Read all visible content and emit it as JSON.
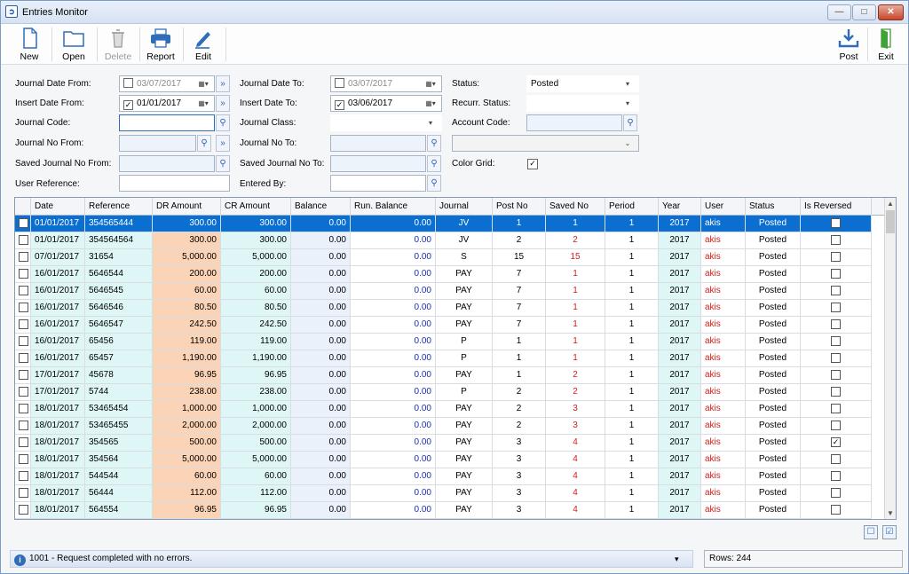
{
  "window": {
    "title": "Entries Monitor",
    "minimize": "—",
    "maximize": "□",
    "close": "✕"
  },
  "toolbar": {
    "new": "New",
    "open": "Open",
    "delete": "Delete",
    "report": "Report",
    "edit": "Edit",
    "post": "Post",
    "exit": "Exit"
  },
  "filters": {
    "journal_date_from_label": "Journal Date From:",
    "journal_date_from": "03/07/2017",
    "insert_date_from_label": "Insert Date From:",
    "insert_date_from": "01/01/2017",
    "journal_code_label": "Journal Code:",
    "journal_no_from_label": "Journal No From:",
    "saved_journal_no_from_label": "Saved Journal No From:",
    "user_reference_label": "User Reference:",
    "journal_date_to_label": "Journal Date To:",
    "journal_date_to": "03/07/2017",
    "insert_date_to_label": "Insert Date To:",
    "insert_date_to": "03/06/2017",
    "journal_class_label": "Journal Class:",
    "journal_no_to_label": "Journal No To:",
    "saved_journal_no_to_label": "Saved Journal No To:",
    "entered_by_label": "Entered By:",
    "status_label": "Status:",
    "status_value": "Posted",
    "recurr_status_label": "Recurr. Status:",
    "account_code_label": "Account Code:",
    "color_grid_label": "Color Grid:"
  },
  "grid": {
    "columns": [
      "Date",
      "Reference",
      "DR Amount",
      "CR Amount",
      "Balance",
      "Run. Balance",
      "Journal",
      "Post No",
      "Saved No",
      "Period",
      "Year",
      "User",
      "Status",
      "Is Reversed"
    ],
    "rows": [
      [
        "01/01/2017",
        "354565444",
        "300.00",
        "300.00",
        "0.00",
        "0.00",
        "JV",
        "1",
        "1",
        "1",
        "2017",
        "akis",
        "Posted",
        ""
      ],
      [
        "01/01/2017",
        "354564564",
        "300.00",
        "300.00",
        "0.00",
        "0.00",
        "JV",
        "2",
        "2",
        "1",
        "2017",
        "akis",
        "Posted",
        ""
      ],
      [
        "07/01/2017",
        "31654",
        "5,000.00",
        "5,000.00",
        "0.00",
        "0.00",
        "S",
        "15",
        "15",
        "1",
        "2017",
        "akis",
        "Posted",
        ""
      ],
      [
        "16/01/2017",
        "5646544",
        "200.00",
        "200.00",
        "0.00",
        "0.00",
        "PAY",
        "7",
        "1",
        "1",
        "2017",
        "akis",
        "Posted",
        ""
      ],
      [
        "16/01/2017",
        "5646545",
        "60.00",
        "60.00",
        "0.00",
        "0.00",
        "PAY",
        "7",
        "1",
        "1",
        "2017",
        "akis",
        "Posted",
        ""
      ],
      [
        "16/01/2017",
        "5646546",
        "80.50",
        "80.50",
        "0.00",
        "0.00",
        "PAY",
        "7",
        "1",
        "1",
        "2017",
        "akis",
        "Posted",
        ""
      ],
      [
        "16/01/2017",
        "5646547",
        "242.50",
        "242.50",
        "0.00",
        "0.00",
        "PAY",
        "7",
        "1",
        "1",
        "2017",
        "akis",
        "Posted",
        ""
      ],
      [
        "16/01/2017",
        "65456",
        "119.00",
        "119.00",
        "0.00",
        "0.00",
        "P",
        "1",
        "1",
        "1",
        "2017",
        "akis",
        "Posted",
        ""
      ],
      [
        "16/01/2017",
        "65457",
        "1,190.00",
        "1,190.00",
        "0.00",
        "0.00",
        "P",
        "1",
        "1",
        "1",
        "2017",
        "akis",
        "Posted",
        ""
      ],
      [
        "17/01/2017",
        "45678",
        "96.95",
        "96.95",
        "0.00",
        "0.00",
        "PAY",
        "1",
        "2",
        "1",
        "2017",
        "akis",
        "Posted",
        ""
      ],
      [
        "17/01/2017",
        "5744",
        "238.00",
        "238.00",
        "0.00",
        "0.00",
        "P",
        "2",
        "2",
        "1",
        "2017",
        "akis",
        "Posted",
        ""
      ],
      [
        "18/01/2017",
        "53465454",
        "1,000.00",
        "1,000.00",
        "0.00",
        "0.00",
        "PAY",
        "2",
        "3",
        "1",
        "2017",
        "akis",
        "Posted",
        ""
      ],
      [
        "18/01/2017",
        "53465455",
        "2,000.00",
        "2,000.00",
        "0.00",
        "0.00",
        "PAY",
        "2",
        "3",
        "1",
        "2017",
        "akis",
        "Posted",
        ""
      ],
      [
        "18/01/2017",
        "354565",
        "500.00",
        "500.00",
        "0.00",
        "0.00",
        "PAY",
        "3",
        "4",
        "1",
        "2017",
        "akis",
        "Posted",
        "✓"
      ],
      [
        "18/01/2017",
        "354564",
        "5,000.00",
        "5,000.00",
        "0.00",
        "0.00",
        "PAY",
        "3",
        "4",
        "1",
        "2017",
        "akis",
        "Posted",
        ""
      ],
      [
        "18/01/2017",
        "544544",
        "60.00",
        "60.00",
        "0.00",
        "0.00",
        "PAY",
        "3",
        "4",
        "1",
        "2017",
        "akis",
        "Posted",
        ""
      ],
      [
        "18/01/2017",
        "56444",
        "112.00",
        "112.00",
        "0.00",
        "0.00",
        "PAY",
        "3",
        "4",
        "1",
        "2017",
        "akis",
        "Posted",
        ""
      ],
      [
        "18/01/2017",
        "564554",
        "96.95",
        "96.95",
        "0.00",
        "0.00",
        "PAY",
        "3",
        "4",
        "1",
        "2017",
        "akis",
        "Posted",
        ""
      ]
    ]
  },
  "statusbar": {
    "message": "1001 -  Request completed with no errors.",
    "rows": "Rows: 244"
  },
  "colors": {
    "selected": "#0a6fd1",
    "dr_cell": "#fbd3b6",
    "cr_cell": "#dff6f6",
    "balance_cell": "#eaf1fb",
    "posted_text": "#d3201a",
    "period_text": "#d3201a",
    "run_balance_text": "#1a2fb0"
  }
}
